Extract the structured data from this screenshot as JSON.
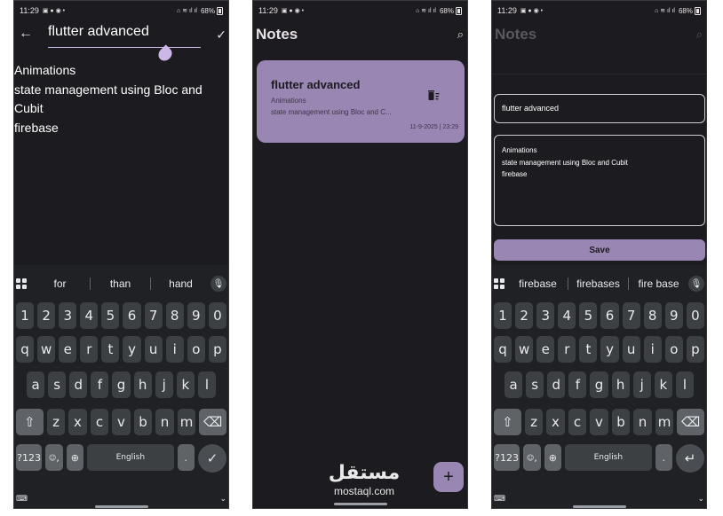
{
  "status": {
    "time": "11:29",
    "battery": "68%",
    "left_icons": "▣ ● ◉ •",
    "right_icons": "⌂ ≋ ıl ıl"
  },
  "editor": {
    "title_value": "flutter advanced",
    "content_value": "Animations\nstate management using Bloc and Cubit\nfirebase"
  },
  "notes_screen": {
    "app_title": "Notes",
    "note": {
      "title": "flutter advanced",
      "line1": "Animations",
      "line2": "state management using Bloc and C...",
      "date": "11-9-2025 | 23:29"
    },
    "fab_label": "+"
  },
  "edit_sheet": {
    "title_value": "flutter advanced",
    "content_value": "Animations\nstate management using Bloc and Cubit\nfirebase",
    "save_label": "Save"
  },
  "keyboard1": {
    "suggestions": [
      "for",
      "than",
      "hand"
    ],
    "space_label": "English"
  },
  "keyboard3": {
    "suggestions": [
      "firebase",
      "firebases",
      "fire base"
    ],
    "space_label": "English"
  },
  "keys": {
    "numbers": [
      "1",
      "2",
      "3",
      "4",
      "5",
      "6",
      "7",
      "8",
      "9",
      "0"
    ],
    "row1": [
      "q",
      "w",
      "e",
      "r",
      "t",
      "y",
      "u",
      "i",
      "o",
      "p"
    ],
    "row2": [
      "a",
      "s",
      "d",
      "f",
      "g",
      "h",
      "j",
      "k",
      "l"
    ],
    "row3": [
      "z",
      "x",
      "c",
      "v",
      "b",
      "n",
      "m"
    ],
    "symbols_label": "?123",
    "comma": ",",
    "emoji": "☺",
    "period": "."
  },
  "watermark": {
    "arabic": "مستقل",
    "english": "mostaql.com"
  }
}
